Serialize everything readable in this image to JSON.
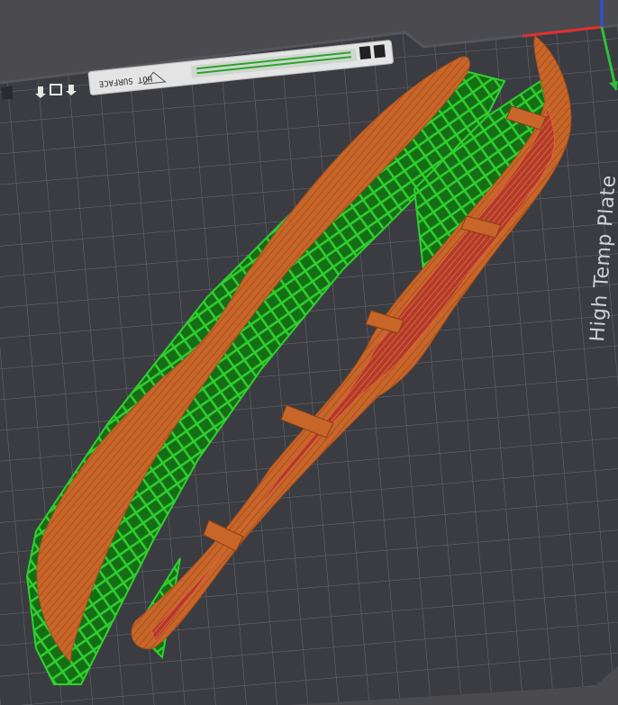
{
  "viewport": {
    "background": "#4a4a4f",
    "plate_color": "#3b3c41",
    "grid_color": "#6b6c73"
  },
  "plate": {
    "label_text": "High Temp Plate",
    "sticker_text": "HOT SURFACE",
    "icons": [
      "arrow-down-icon",
      "square-icon",
      "arrow-down-icon"
    ]
  },
  "axes": {
    "x_color": "#e03030",
    "y_color": "#2fbf3f",
    "z_color": "#3050e0"
  },
  "model": {
    "wall_color": "#c8662a",
    "inner_color": "#b23a2a",
    "support_color": "#1fa81f"
  }
}
